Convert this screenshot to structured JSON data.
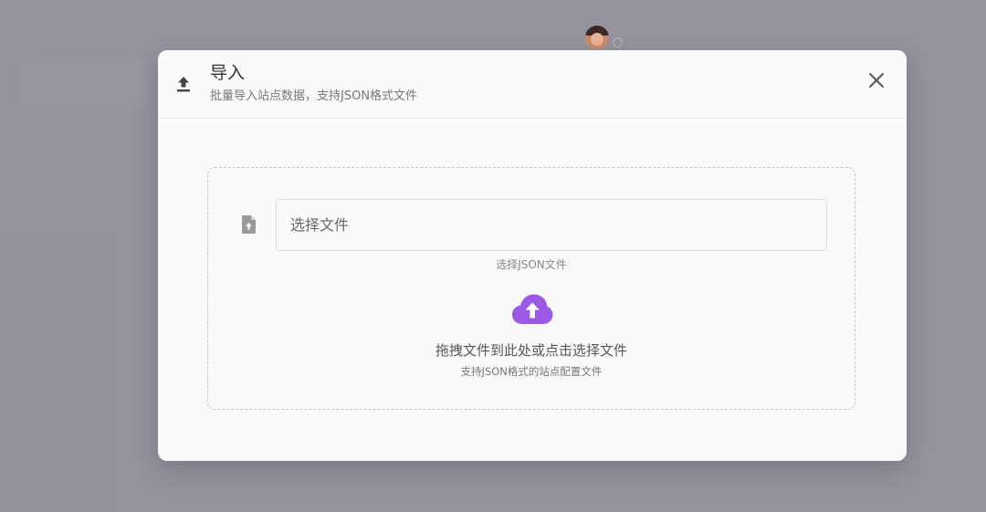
{
  "modal": {
    "title": "导入",
    "subtitle": "批量导入站点数据，支持JSON格式文件",
    "header_icon": "upload-icon",
    "close_icon": "close-icon"
  },
  "file_picker": {
    "icon": "file-upload-icon",
    "placeholder": "选择文件",
    "hint": "选择JSON文件"
  },
  "dropzone": {
    "icon": "cloud-upload-icon",
    "text": "拖拽文件到此处或点击选择文件",
    "subtext": "支持JSON格式的站点配置文件"
  },
  "colors": {
    "accent": "#9b59e6",
    "overlay": "#5f5d6c"
  }
}
